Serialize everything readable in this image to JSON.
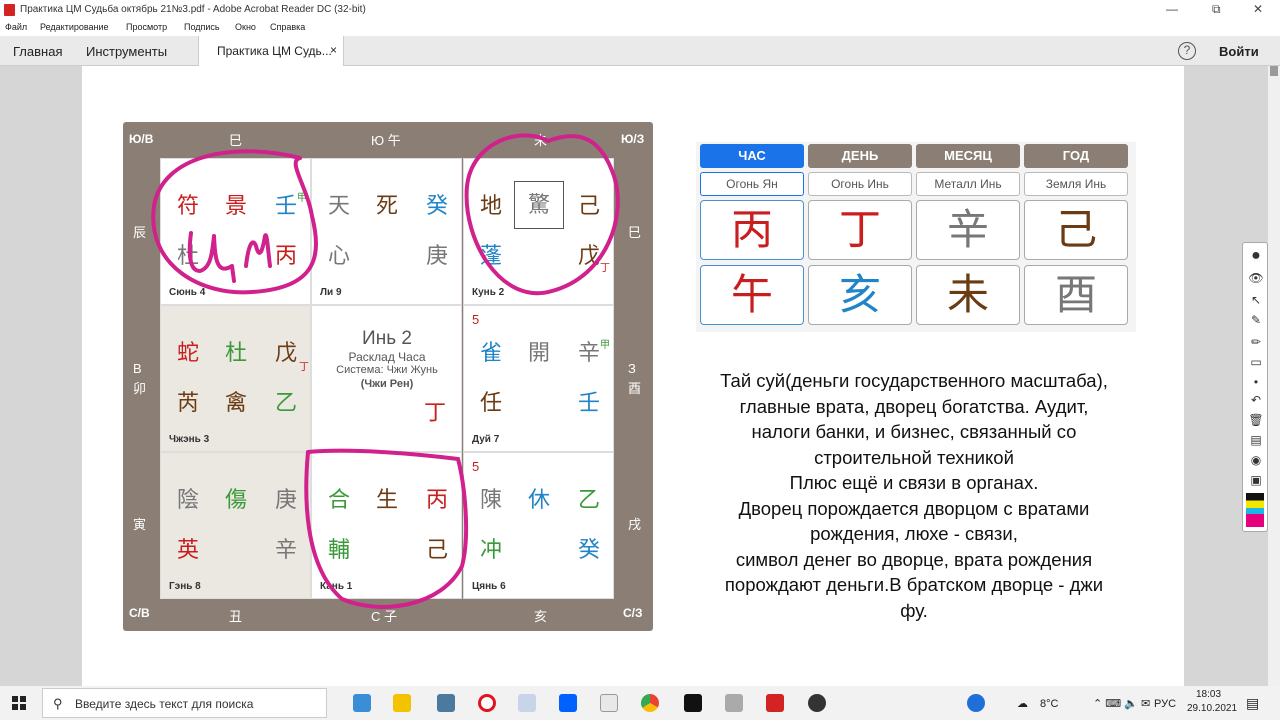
{
  "window": {
    "title": "Практика ЦМ Судьба октябрь 21№3.pdf - Adobe Acrobat Reader DC (32-bit)"
  },
  "menu": [
    "Файл",
    "Редактирование",
    "Просмотр",
    "Подпись",
    "Окно",
    "Справка"
  ],
  "tabs": {
    "home": "Главная",
    "tools": "Инструменты",
    "document": "Практика ЦМ Судь...",
    "close": "×",
    "signin": "Войти",
    "help": "?"
  },
  "grid": {
    "corners": {
      "sw": "Ю/В",
      "se": "Ю/З",
      "nw": "С/В",
      "ne": "С/З"
    },
    "top_labels": [
      "巳",
      "Ю 午",
      "未"
    ],
    "bottom_labels": [
      "丑",
      "С 子",
      "亥"
    ],
    "left_labels": [
      "辰",
      "В\n卯",
      "寅"
    ],
    "right_labels": [
      "巳",
      "З\n酉",
      "戌"
    ],
    "cells": [
      {
        "label": "Сюнь 4",
        "chars": [
          {
            "t": "符",
            "c": "red"
          },
          {
            "t": "景",
            "c": "red"
          },
          {
            "t": "壬",
            "c": "blu"
          },
          {
            "t": "杜",
            "c": "gry"
          },
          {
            "t": "",
            "c": "gry"
          },
          {
            "t": "丙",
            "c": "red"
          }
        ],
        "small": "甲"
      },
      {
        "label": "Ли 9",
        "chars": [
          {
            "t": "天",
            "c": "gry"
          },
          {
            "t": "死",
            "c": "brn"
          },
          {
            "t": "癸",
            "c": "blu"
          },
          {
            "t": "心",
            "c": "gry"
          },
          {
            "t": "",
            "c": "gry"
          },
          {
            "t": "庚",
            "c": "gry"
          }
        ],
        "small": ""
      },
      {
        "label": "Кунь 2",
        "chars": [
          {
            "t": "地",
            "c": "brn"
          },
          {
            "t": "驚",
            "c": "gry"
          },
          {
            "t": "己",
            "c": "brn"
          },
          {
            "t": "蓬",
            "c": "blu"
          },
          {
            "t": "",
            "c": "gry"
          },
          {
            "t": "戊",
            "c": "brn"
          }
        ],
        "small": "丁"
      },
      {
        "label": "Чжэнь 3",
        "chars": [
          {
            "t": "蛇",
            "c": "red"
          },
          {
            "t": "杜",
            "c": "grn"
          },
          {
            "t": "戊",
            "c": "brn"
          },
          {
            "t": "芮",
            "c": "brn"
          },
          {
            "t": "禽",
            "c": "brn"
          },
          {
            "t": "乙",
            "c": "grn"
          }
        ],
        "small": "丁"
      },
      {
        "label": "",
        "center": {
          "title": "Инь 2",
          "line1": "Расклад Часа",
          "line2": "Система: Чжи Жунь",
          "line3": "(Чжи Рен)",
          "mark": "丁"
        }
      },
      {
        "label": "Дуй 7",
        "chars": [
          {
            "t": "雀",
            "c": "blu"
          },
          {
            "t": "開",
            "c": "gry"
          },
          {
            "t": "辛",
            "c": "gry"
          },
          {
            "t": "任",
            "c": "brn"
          },
          {
            "t": "",
            "c": "gry"
          },
          {
            "t": "壬",
            "c": "blu"
          }
        ],
        "small": "甲",
        "num": "5"
      },
      {
        "label": "Гэнь 8",
        "chars": [
          {
            "t": "陰",
            "c": "gry"
          },
          {
            "t": "傷",
            "c": "grn"
          },
          {
            "t": "庚",
            "c": "gry"
          },
          {
            "t": "英",
            "c": "red"
          },
          {
            "t": "",
            "c": "gry"
          },
          {
            "t": "辛",
            "c": "gry"
          }
        ],
        "small": ""
      },
      {
        "label": "Кань 1",
        "chars": [
          {
            "t": "合",
            "c": "grn"
          },
          {
            "t": "生",
            "c": "brn"
          },
          {
            "t": "丙",
            "c": "red"
          },
          {
            "t": "輔",
            "c": "grn"
          },
          {
            "t": "",
            "c": "gry"
          },
          {
            "t": "己",
            "c": "brn"
          }
        ],
        "small": ""
      },
      {
        "label": "Цянь 6",
        "chars": [
          {
            "t": "陳",
            "c": "gry"
          },
          {
            "t": "休",
            "c": "blu"
          },
          {
            "t": "乙",
            "c": "grn"
          },
          {
            "t": "冲",
            "c": "grn"
          },
          {
            "t": "",
            "c": "gry"
          },
          {
            "t": "癸",
            "c": "blu"
          }
        ],
        "small": "",
        "num": "5"
      }
    ],
    "handwriting": "ЦМ"
  },
  "pillars": {
    "headers": [
      "ЧАС",
      "ДЕНЬ",
      "МЕСЯЦ",
      "ГОД"
    ],
    "elements": [
      "Огонь Ян",
      "Огонь Инь",
      "Металл Инь",
      "Земля Инь"
    ],
    "stems": [
      {
        "t": "丙",
        "c": "#c81e1e"
      },
      {
        "t": "丁",
        "c": "#c81e1e"
      },
      {
        "t": "辛",
        "c": "#777"
      },
      {
        "t": "己",
        "c": "#6b3c14"
      }
    ],
    "branches": [
      {
        "t": "午",
        "c": "#c81e1e"
      },
      {
        "t": "亥",
        "c": "#1f84c8"
      },
      {
        "t": "未",
        "c": "#6b3c14"
      },
      {
        "t": "酉",
        "c": "#777"
      }
    ]
  },
  "notes": [
    "Тай суй(деньги государственного масштаба),",
    "главные врата, дворец богатства. Аудит,",
    "налоги банки, и бизнес, связанный со",
    "строительной техникой",
    "Плюс ещё и связи в органах.",
    "Дворец порождается дворцом с вратами",
    "рождения, люхе - связи,",
    "символ денег во дворце, врата рождения",
    "порождают деньги.В братском дворце - джи",
    "фу."
  ],
  "taskbar": {
    "search_placeholder": "Введите здесь текст для поиска",
    "temp": "8°C",
    "lang": "РУС",
    "time": "18:03",
    "date": "29.10.2021"
  }
}
